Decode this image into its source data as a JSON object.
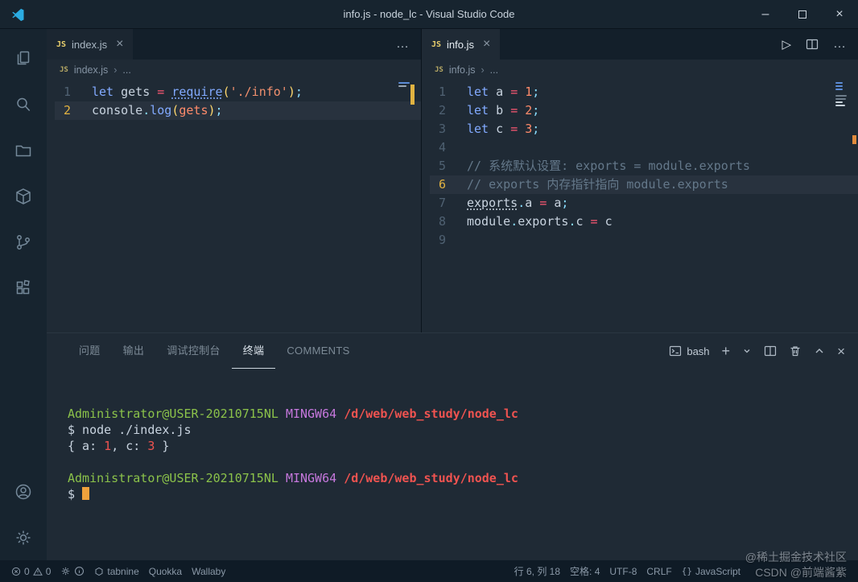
{
  "window": {
    "title": "info.js - node_lc - Visual Studio Code"
  },
  "labels": {
    "js_badge": "JS",
    "crumb_sep": "›"
  },
  "colors": {
    "accent": "#2bace2",
    "keyword": "#82aaff",
    "operator": "#ff5874",
    "string": "#f1906e",
    "comment": "#64788a",
    "active_line_number": "#e3b341",
    "terminal_green": "#8bc24a",
    "terminal_magenta": "#c678dd",
    "terminal_red": "#ef5350"
  },
  "activity_bar": {
    "items": [
      "explorer",
      "search",
      "folder",
      "package",
      "source-control",
      "extensions"
    ],
    "bottom_items": [
      "account",
      "settings"
    ]
  },
  "editors": [
    {
      "tab": "index.js",
      "breadcrumb": {
        "file": "index.js",
        "more": "..."
      },
      "lines": [
        {
          "n": "1",
          "tokens": [
            [
              "let ",
              "kw"
            ],
            [
              "gets ",
              "d"
            ],
            [
              "= ",
              "op"
            ],
            [
              "require",
              "kw u"
            ],
            [
              "(",
              "par"
            ],
            [
              "'./info'",
              "str"
            ],
            [
              ")",
              "par"
            ],
            [
              ";",
              "pun"
            ]
          ]
        },
        {
          "n": "2",
          "active": true,
          "tokens": [
            [
              "console",
              "d"
            ],
            [
              ".",
              "pun"
            ],
            [
              "log",
              "kw"
            ],
            [
              "(",
              "par"
            ],
            [
              "gets",
              "num"
            ],
            [
              ")",
              "par"
            ],
            [
              ";",
              "pun"
            ]
          ]
        }
      ]
    },
    {
      "tab": "info.js",
      "breadcrumb": {
        "file": "info.js",
        "more": "..."
      },
      "lines": [
        {
          "n": "1",
          "tokens": [
            [
              "let ",
              "kw"
            ],
            [
              "a ",
              "d"
            ],
            [
              "= ",
              "op"
            ],
            [
              "1",
              "num"
            ],
            [
              ";",
              "pun"
            ]
          ]
        },
        {
          "n": "2",
          "tokens": [
            [
              "let ",
              "kw"
            ],
            [
              "b ",
              "d"
            ],
            [
              "= ",
              "op"
            ],
            [
              "2",
              "num"
            ],
            [
              ";",
              "pun"
            ]
          ]
        },
        {
          "n": "3",
          "tokens": [
            [
              "let ",
              "kw"
            ],
            [
              "c ",
              "d"
            ],
            [
              "= ",
              "op"
            ],
            [
              "3",
              "num"
            ],
            [
              ";",
              "pun"
            ]
          ]
        },
        {
          "n": "4",
          "tokens": []
        },
        {
          "n": "5",
          "tokens": [
            [
              "// 系统默认设置: exports = module.exports",
              "com"
            ]
          ]
        },
        {
          "n": "6",
          "active": true,
          "tokens": [
            [
              "// exports 内存指针指向 module.exports",
              "com"
            ]
          ]
        },
        {
          "n": "7",
          "tokens": [
            [
              "exports",
              "d u"
            ],
            [
              ".",
              "pun"
            ],
            [
              "a ",
              "d"
            ],
            [
              "= ",
              "op"
            ],
            [
              "a",
              "d"
            ],
            [
              ";",
              "pun"
            ]
          ]
        },
        {
          "n": "8",
          "tokens": [
            [
              "module",
              "d"
            ],
            [
              ".",
              "pun"
            ],
            [
              "exports",
              "d"
            ],
            [
              ".",
              "pun"
            ],
            [
              "c ",
              "d"
            ],
            [
              "= ",
              "op"
            ],
            [
              "c",
              "d"
            ]
          ]
        },
        {
          "n": "9",
          "tokens": []
        }
      ]
    }
  ],
  "panel": {
    "tabs": [
      {
        "label": "问题"
      },
      {
        "label": "输出"
      },
      {
        "label": "调试控制台"
      },
      {
        "label": "终端",
        "active": true
      },
      {
        "label": "COMMENTS"
      }
    ],
    "shell_label": "bash",
    "terminal_lines": [
      {
        "segments": []
      },
      {
        "segments": [
          [
            "Administrator@USER-20210715NL ",
            "green"
          ],
          [
            "MINGW64 ",
            "magenta"
          ],
          [
            "/d/web/web_study/node_lc",
            "red b"
          ]
        ]
      },
      {
        "segments": [
          [
            "$ node ./index.js",
            "d"
          ]
        ]
      },
      {
        "segments": [
          [
            "{ a: ",
            "d"
          ],
          [
            "1",
            "red"
          ],
          [
            ", c: ",
            "d"
          ],
          [
            "3",
            "red"
          ],
          [
            " }",
            "d"
          ]
        ]
      },
      {
        "segments": []
      },
      {
        "segments": [
          [
            "Administrator@USER-20210715NL ",
            "green"
          ],
          [
            "MINGW64 ",
            "magenta"
          ],
          [
            "/d/web/web_study/node_lc",
            "red b"
          ]
        ]
      },
      {
        "segments": [
          [
            "$ ",
            "d"
          ],
          [
            "",
            "cursor"
          ]
        ]
      }
    ]
  },
  "status_bar": {
    "errors": "0",
    "warnings": "0",
    "tabnine": "tabnine",
    "quokka": "Quokka",
    "wallaby": "Wallaby",
    "line_col": "行 6, 列 18",
    "spaces": "空格: 4",
    "encoding": "UTF-8",
    "eol": "CRLF",
    "language": "JavaScript",
    "braces_icon": "{}"
  },
  "watermark": {
    "line1": "@稀土掘金技术社区",
    "line2": "CSDN @前端酱紫"
  }
}
